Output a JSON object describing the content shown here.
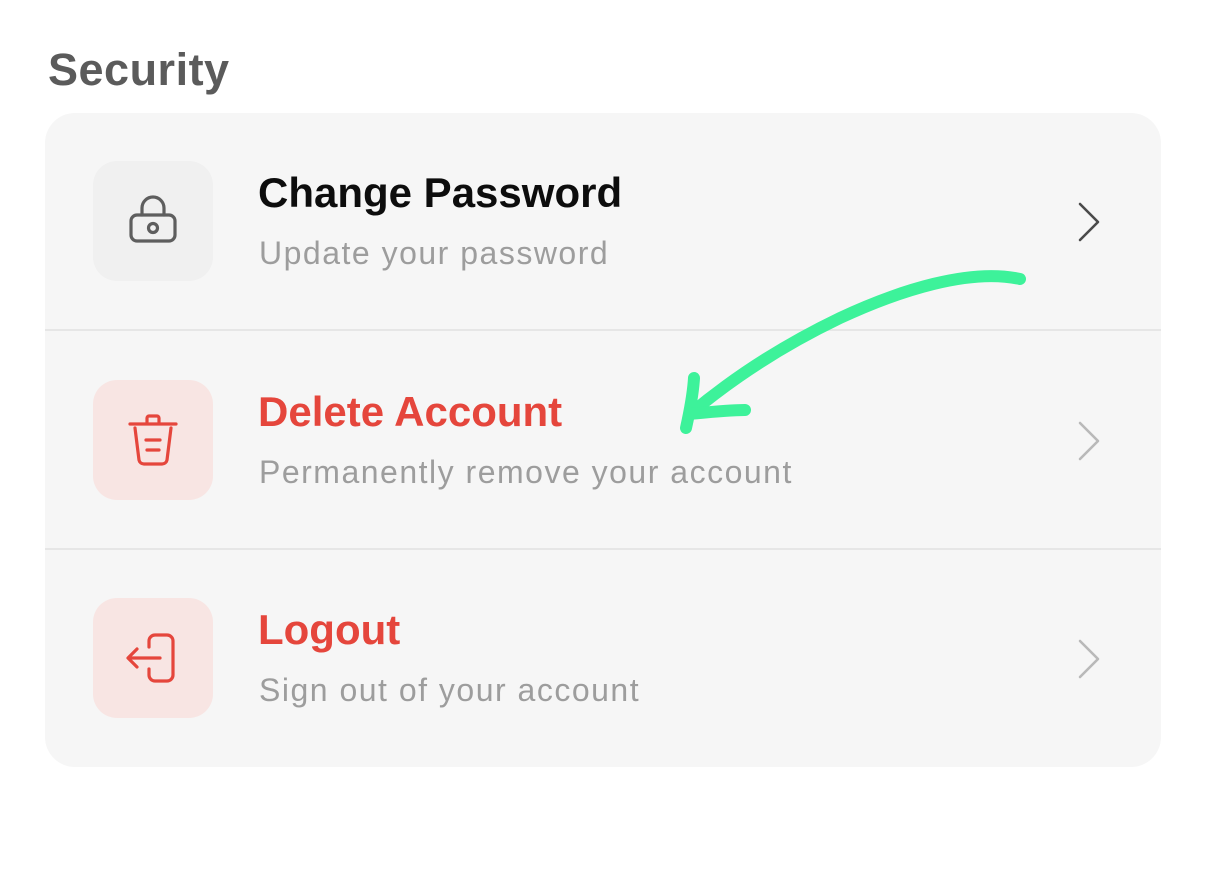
{
  "section": {
    "title": "Security"
  },
  "items": [
    {
      "title": "Change Password",
      "subtitle": "Update your password",
      "icon": "lock-icon",
      "tone": "neutral"
    },
    {
      "title": "Delete Account",
      "subtitle": "Permanently remove your account",
      "icon": "trash-icon",
      "tone": "danger"
    },
    {
      "title": "Logout",
      "subtitle": "Sign out of your account",
      "icon": "logout-icon",
      "tone": "danger"
    }
  ],
  "colors": {
    "danger": "#e5463c",
    "danger_bg": "#f8e5e3",
    "card_bg": "#f6f6f6",
    "annotation": "#3df29a"
  }
}
